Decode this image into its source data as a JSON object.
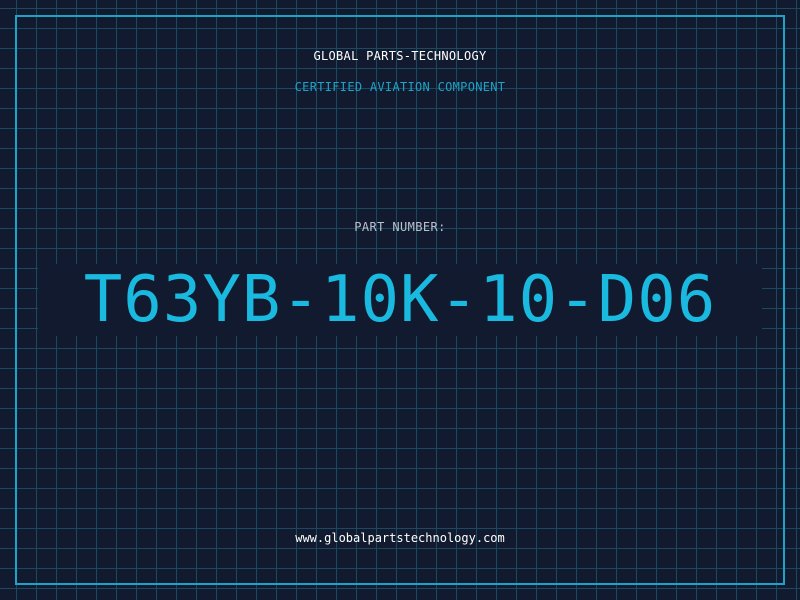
{
  "header": {
    "company": "GLOBAL PARTS-TECHNOLOGY",
    "subtitle": "CERTIFIED AVIATION COMPONENT"
  },
  "part": {
    "label": "PART NUMBER:",
    "number": "T63YB-10K-10-D06"
  },
  "footer": {
    "website": "www.globalpartstechnology.com"
  },
  "colors": {
    "background": "#111a2e",
    "grid": "#1b4a60",
    "accent": "#1ea3c8",
    "part_number": "#1ab9df",
    "text": "#ffffff"
  }
}
